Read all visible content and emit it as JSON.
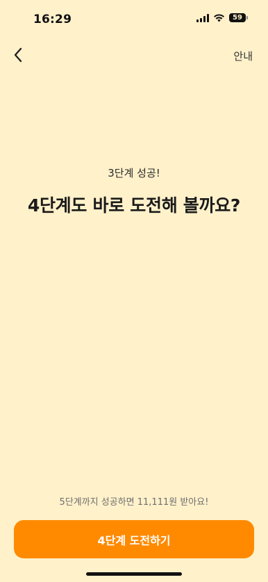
{
  "status_bar": {
    "time": "16:29",
    "battery_level": "59",
    "signal_icon": "cellular-signal-icon",
    "wifi_icon": "wifi-icon",
    "battery_icon": "battery-icon"
  },
  "nav": {
    "back_icon": "chevron-left-icon",
    "guide_label": "안내"
  },
  "main": {
    "subtitle": "3단계 성공!",
    "headline": "4단계도 바로 도전해 볼까요?"
  },
  "footer": {
    "reward_note": "5단계까지 성공하면 11,111원 받아요!",
    "cta_label": "4단계 도전하기"
  },
  "colors": {
    "background": "#FFF1CA",
    "accent": "#FF8A00"
  }
}
